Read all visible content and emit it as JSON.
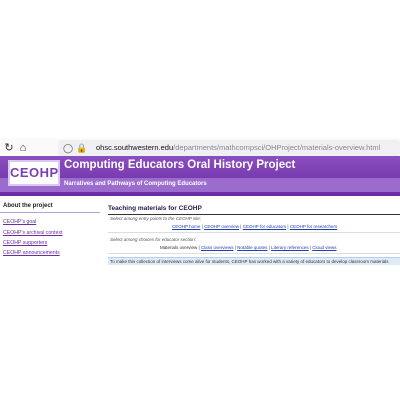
{
  "browser": {
    "url_host": "ohsc.southwestern.edu",
    "url_path": "/departments/mathcompsci/OHProject/materials-overview.html",
    "icons": [
      "reload-icon",
      "home-icon",
      "shield-icon",
      "lock-icon"
    ]
  },
  "site": {
    "logo": "CEOHP",
    "title": "Computing Educators Oral History Project",
    "subtitle": "Narratives and Pathways of Computing Educators"
  },
  "sidebar": {
    "heading": "About the project",
    "links": [
      "CEOHP's goal",
      "CEOHP's archival context",
      "CEOHP supporters",
      "CEOHP announcements"
    ]
  },
  "main": {
    "heading": "Teaching materials for CEOHP",
    "choose_entry_label": "Select among entry points to the CEOHP site:",
    "entry_links": [
      "CEOHP home",
      "CEOHP overview",
      "CEOHP for educators",
      "CEOHP for researchers"
    ],
    "choose_section_label": "Select among choices for educator section:",
    "section_current": "Materials overview",
    "section_links": [
      "Class overviews",
      "Notable quotes",
      "Literary references",
      "Cloud views"
    ],
    "info_text": "To make this collection of interviews come alive for students, CEOHP has worked with a variety of educators to develop classroom materials"
  },
  "colors": {
    "header_purple": "#6b2ba3",
    "subheader_purple": "#9b6ccd",
    "link_blue": "#2240b0",
    "sidebar_link": "#6a2ea0",
    "info_bg": "#dfeaf7"
  }
}
